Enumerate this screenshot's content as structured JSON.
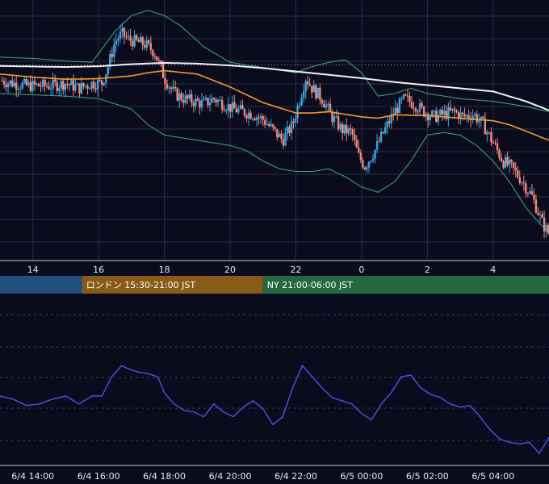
{
  "theme": {
    "background": "#0b0b1e",
    "grid": "#2a2d45",
    "up_candle": "#3aa7e0",
    "down_candle": "#ee8a7a",
    "bollinger": "#3fae76",
    "ma_fast": "#f59a2a",
    "ma_slow": "#f2f2f2",
    "oscillator": "#4a55e6",
    "session_tokyo": "#234f7f",
    "session_london": "#8a5a17",
    "session_ny": "#24683f"
  },
  "sessions": [
    {
      "label": "",
      "start_hour": 13.0,
      "end_hour": 15.5,
      "color": "#234f7f"
    },
    {
      "label": "ロンドン 15:30-21:00 JST",
      "start_hour": 15.5,
      "end_hour": 21.0,
      "color": "#8a5a17"
    },
    {
      "label": "NY 21:00-06:00 JST",
      "start_hour": 21.0,
      "end_hour": 30.0,
      "color": "#24683f"
    }
  ],
  "chart_data": [
    {
      "type": "candlestick",
      "panel": "price",
      "x_range": [
        13.0,
        29.7
      ],
      "y_range": [
        0,
        100
      ],
      "grid": true,
      "x_ticks": [
        {
          "x": 14,
          "label": "14"
        },
        {
          "x": 16,
          "label": "16"
        },
        {
          "x": 18,
          "label": "18"
        },
        {
          "x": 20,
          "label": "20"
        },
        {
          "x": 22,
          "label": "22"
        },
        {
          "x": 24,
          "label": "0"
        },
        {
          "x": 26,
          "label": "2"
        },
        {
          "x": 28,
          "label": "4"
        }
      ],
      "reference_line_y": 75,
      "series": [
        {
          "kind": "price",
          "points": [
            [
              13.0,
              69
            ],
            [
              13.4,
              68
            ],
            [
              13.8,
              67
            ],
            [
              14.2,
              67
            ],
            [
              14.6,
              67
            ],
            [
              15.0,
              68
            ],
            [
              15.4,
              66
            ],
            [
              15.8,
              68
            ],
            [
              16.1,
              68
            ],
            [
              16.3,
              75
            ],
            [
              16.5,
              84
            ],
            [
              16.7,
              87
            ],
            [
              16.9,
              85
            ],
            [
              17.1,
              84
            ],
            [
              17.4,
              83
            ],
            [
              17.7,
              80
            ],
            [
              18.0,
              70
            ],
            [
              18.3,
              64
            ],
            [
              18.6,
              62
            ],
            [
              18.9,
              61
            ],
            [
              19.2,
              60
            ],
            [
              19.5,
              62
            ],
            [
              19.8,
              60
            ],
            [
              20.1,
              58
            ],
            [
              20.4,
              57
            ],
            [
              20.7,
              56
            ],
            [
              21.0,
              54
            ],
            [
              21.3,
              50
            ],
            [
              21.6,
              46
            ],
            [
              21.9,
              52
            ],
            [
              22.1,
              61
            ],
            [
              22.3,
              70
            ],
            [
              22.5,
              66
            ],
            [
              22.8,
              62
            ],
            [
              23.1,
              55
            ],
            [
              23.4,
              50
            ],
            [
              23.7,
              49
            ],
            [
              23.9,
              40
            ],
            [
              24.1,
              36
            ],
            [
              24.4,
              42
            ],
            [
              24.7,
              50
            ],
            [
              25.0,
              57
            ],
            [
              25.3,
              62
            ],
            [
              25.6,
              60
            ],
            [
              25.9,
              57
            ],
            [
              26.2,
              55
            ],
            [
              26.5,
              56
            ],
            [
              26.8,
              57
            ],
            [
              27.1,
              55
            ],
            [
              27.4,
              56
            ],
            [
              27.7,
              52
            ],
            [
              28.0,
              45
            ],
            [
              28.3,
              38
            ],
            [
              28.6,
              35
            ],
            [
              28.9,
              30
            ],
            [
              29.2,
              24
            ],
            [
              29.5,
              14
            ],
            [
              29.7,
              10
            ]
          ]
        },
        {
          "kind": "ma_fast",
          "points": [
            [
              13.0,
              71.5
            ],
            [
              14.0,
              70.3
            ],
            [
              15.0,
              69.5
            ],
            [
              16.0,
              69.7
            ],
            [
              17.0,
              70.8
            ],
            [
              17.5,
              72.0
            ],
            [
              18.0,
              72.8
            ],
            [
              19.0,
              71.5
            ],
            [
              20.0,
              66.5
            ],
            [
              21.0,
              60.5
            ],
            [
              22.0,
              56.5
            ],
            [
              22.5,
              56.5
            ],
            [
              23.0,
              57.0
            ],
            [
              24.0,
              55.0
            ],
            [
              24.5,
              54.5
            ],
            [
              25.0,
              55.8
            ],
            [
              26.0,
              55.5
            ],
            [
              27.0,
              54.5
            ],
            [
              28.0,
              53.5
            ],
            [
              28.5,
              52.0
            ],
            [
              29.0,
              49.5
            ],
            [
              29.7,
              46.0
            ]
          ]
        },
        {
          "kind": "ma_slow",
          "points": [
            [
              13.0,
              74.6
            ],
            [
              14.0,
              74.4
            ],
            [
              15.0,
              74.2
            ],
            [
              16.0,
              74.5
            ],
            [
              17.0,
              75.3
            ],
            [
              18.0,
              75.8
            ],
            [
              19.0,
              75.5
            ],
            [
              20.0,
              74.8
            ],
            [
              21.0,
              73.8
            ],
            [
              22.0,
              72.5
            ],
            [
              23.0,
              71.2
            ],
            [
              24.0,
              69.9
            ],
            [
              25.0,
              68.4
            ],
            [
              26.0,
              67.2
            ],
            [
              27.0,
              66.0
            ],
            [
              28.0,
              64.8
            ],
            [
              29.0,
              61.0
            ],
            [
              29.7,
              57.5
            ]
          ]
        },
        {
          "kind": "bb_upper",
          "points": [
            [
              13.0,
              78
            ],
            [
              14.0,
              77.5
            ],
            [
              15.0,
              76.5
            ],
            [
              15.8,
              76
            ],
            [
              16.5,
              88
            ],
            [
              17.0,
              94
            ],
            [
              17.5,
              96
            ],
            [
              18.0,
              94
            ],
            [
              18.5,
              90
            ],
            [
              19.2,
              82
            ],
            [
              20.0,
              76
            ],
            [
              21.0,
              74
            ],
            [
              22.0,
              72
            ],
            [
              22.4,
              74
            ],
            [
              23.0,
              76
            ],
            [
              23.5,
              77
            ],
            [
              24.0,
              72
            ],
            [
              24.5,
              63
            ],
            [
              25.0,
              64
            ],
            [
              25.5,
              66
            ],
            [
              26.0,
              64
            ],
            [
              26.5,
              63
            ],
            [
              27.0,
              62
            ],
            [
              28.0,
              61
            ],
            [
              28.5,
              60
            ],
            [
              29.0,
              59
            ],
            [
              29.7,
              57
            ]
          ]
        },
        {
          "kind": "bb_lower",
          "points": [
            [
              13.0,
              64
            ],
            [
              14.0,
              63.5
            ],
            [
              15.0,
              63
            ],
            [
              16.0,
              62
            ],
            [
              17.0,
              58
            ],
            [
              17.5,
              52
            ],
            [
              18.0,
              48
            ],
            [
              19.0,
              46
            ],
            [
              20.0,
              44
            ],
            [
              20.5,
              42
            ],
            [
              21.0,
              38
            ],
            [
              21.5,
              35
            ],
            [
              22.0,
              34
            ],
            [
              22.5,
              34
            ],
            [
              23.0,
              35
            ],
            [
              23.5,
              32
            ],
            [
              24.0,
              28
            ],
            [
              24.5,
              26
            ],
            [
              25.0,
              30
            ],
            [
              25.5,
              38
            ],
            [
              26.0,
              48
            ],
            [
              26.5,
              49
            ],
            [
              27.0,
              48
            ],
            [
              27.5,
              44
            ],
            [
              28.0,
              38
            ],
            [
              28.5,
              30
            ],
            [
              29.0,
              20
            ],
            [
              29.7,
              10
            ]
          ]
        }
      ]
    },
    {
      "type": "line",
      "panel": "oscillator",
      "x_range": [
        13.0,
        29.7
      ],
      "y_range": [
        0,
        100
      ],
      "grid": true,
      "x_ticks": [
        {
          "x": 14,
          "label": "6/4 14:00"
        },
        {
          "x": 16,
          "label": "6/4 16:00"
        },
        {
          "x": 18,
          "label": "6/4 18:00"
        },
        {
          "x": 20,
          "label": "6/4 20:00"
        },
        {
          "x": 22,
          "label": "6/4 22:00"
        },
        {
          "x": 24,
          "label": "6/5 00:00"
        },
        {
          "x": 26,
          "label": "6/5 02:00"
        },
        {
          "x": 28,
          "label": "6/5 04:00"
        }
      ],
      "series": [
        {
          "points": [
            [
              13.0,
              43
            ],
            [
              13.4,
              41
            ],
            [
              13.8,
              37
            ],
            [
              14.2,
              38
            ],
            [
              14.6,
              41
            ],
            [
              15.0,
              43
            ],
            [
              15.4,
              38
            ],
            [
              15.8,
              43
            ],
            [
              16.1,
              43
            ],
            [
              16.4,
              55
            ],
            [
              16.7,
              62
            ],
            [
              16.9,
              60
            ],
            [
              17.2,
              58
            ],
            [
              17.5,
              57
            ],
            [
              17.8,
              55
            ],
            [
              18.0,
              45
            ],
            [
              18.3,
              38
            ],
            [
              18.6,
              34
            ],
            [
              18.9,
              33
            ],
            [
              19.2,
              30
            ],
            [
              19.5,
              38
            ],
            [
              19.8,
              33
            ],
            [
              20.1,
              30
            ],
            [
              20.4,
              36
            ],
            [
              20.7,
              40
            ],
            [
              21.0,
              35
            ],
            [
              21.3,
              25
            ],
            [
              21.6,
              30
            ],
            [
              21.9,
              48
            ],
            [
              22.2,
              62
            ],
            [
              22.5,
              55
            ],
            [
              22.8,
              48
            ],
            [
              23.1,
              42
            ],
            [
              23.4,
              40
            ],
            [
              23.7,
              38
            ],
            [
              24.0,
              32
            ],
            [
              24.3,
              28
            ],
            [
              24.6,
              38
            ],
            [
              24.9,
              45
            ],
            [
              25.2,
              55
            ],
            [
              25.5,
              56
            ],
            [
              25.8,
              48
            ],
            [
              26.1,
              44
            ],
            [
              26.4,
              42
            ],
            [
              26.7,
              38
            ],
            [
              27.0,
              36
            ],
            [
              27.3,
              37
            ],
            [
              27.6,
              30
            ],
            [
              27.9,
              22
            ],
            [
              28.2,
              16
            ],
            [
              28.5,
              14
            ],
            [
              28.8,
              13
            ],
            [
              29.1,
              14
            ],
            [
              29.4,
              7
            ],
            [
              29.7,
              17
            ]
          ]
        }
      ]
    }
  ]
}
